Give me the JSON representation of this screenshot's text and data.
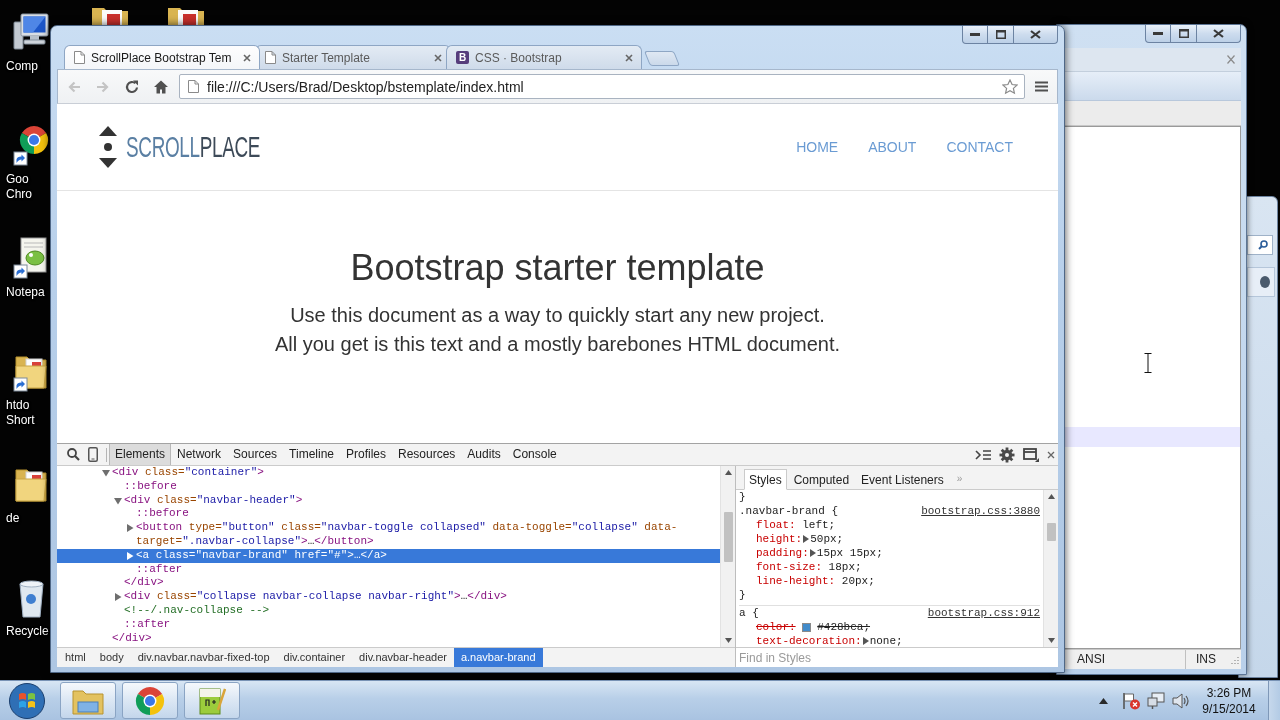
{
  "desktop_icons": [
    {
      "kind": "computer",
      "label_lines": [
        "Comp"
      ]
    },
    {
      "kind": "browser",
      "label_lines": [
        "Goo",
        "Chro"
      ]
    },
    {
      "kind": "notepad",
      "label_lines": [
        "Notepa"
      ]
    },
    {
      "kind": "folder_shortcut",
      "label_lines": [
        "htdo",
        "Short"
      ]
    },
    {
      "kind": "folder",
      "label_lines": [
        "de"
      ]
    },
    {
      "kind": "recycle_bin",
      "label_lines": [
        "Recycle"
      ]
    }
  ],
  "browser": {
    "tabs": [
      {
        "title": "ScrollPlace Bootstrap Tem",
        "kind": "page",
        "selected": true
      },
      {
        "title": "Starter Template",
        "kind": "page",
        "selected": false
      },
      {
        "title": "CSS · Bootstrap",
        "kind": "lettered",
        "favicon_letter": "B",
        "selected": false
      }
    ],
    "nav_buttons": [
      {
        "kind": "back",
        "disabled": true
      },
      {
        "kind": "forward",
        "disabled": true
      },
      {
        "kind": "reload",
        "disabled": false
      },
      {
        "kind": "home",
        "disabled": false
      }
    ],
    "address": "file:///C:/Users/Brad/Desktop/bstemplate/index.html",
    "page": {
      "brand": {
        "first": "SCROLL",
        "second": "PLACE"
      },
      "nav_links": [
        "HOME",
        "ABOUT",
        "CONTACT"
      ],
      "heading": "Bootstrap starter template",
      "lead_lines": [
        "Use this document as a way to quickly start any new project.",
        "All you get is this text and a mostly barebones HTML document."
      ]
    },
    "devtools": {
      "tools": [
        {
          "label": "Elements",
          "selected": true
        },
        {
          "label": "Network",
          "selected": false
        },
        {
          "label": "Sources",
          "selected": false
        },
        {
          "label": "Timeline",
          "selected": false
        },
        {
          "label": "Profiles",
          "selected": false
        },
        {
          "label": "Resources",
          "selected": false
        },
        {
          "label": "Audits",
          "selected": false
        },
        {
          "label": "Console",
          "selected": false
        }
      ],
      "dom_tree": [
        {
          "segments": [
            {
              "kind": "tag",
              "text": "<div"
            },
            {
              "kind": "attr",
              "text": " class="
            },
            {
              "kind": "value",
              "text": "\"container\""
            },
            {
              "kind": "tag",
              "text": ">"
            }
          ],
          "expanded": true,
          "selected": false,
          "children": [
            {
              "segments": [
                {
                  "kind": "pseudo",
                  "text": "::before"
                }
              ],
              "selected": false
            },
            {
              "segments": [
                {
                  "kind": "tag",
                  "text": "<div"
                },
                {
                  "kind": "attr",
                  "text": " class="
                },
                {
                  "kind": "value",
                  "text": "\"navbar-header\""
                },
                {
                  "kind": "tag",
                  "text": ">"
                }
              ],
              "expanded": true,
              "selected": false,
              "children": [
                {
                  "segments": [
                    {
                      "kind": "pseudo",
                      "text": "::before"
                    }
                  ],
                  "selected": false
                },
                {
                  "segments": [
                    {
                      "kind": "tag",
                      "text": "<button"
                    },
                    {
                      "kind": "attr",
                      "text": " type="
                    },
                    {
                      "kind": "value",
                      "text": "\"button\""
                    },
                    {
                      "kind": "attr",
                      "text": " class="
                    },
                    {
                      "kind": "value",
                      "text": "\"navbar-toggle collapsed\""
                    },
                    {
                      "kind": "attr",
                      "text": " data-toggle="
                    },
                    {
                      "kind": "value",
                      "text": "\"collapse\""
                    },
                    {
                      "kind": "attr",
                      "text": " data-target="
                    },
                    {
                      "kind": "value",
                      "text": "\".navbar-collapse\""
                    },
                    {
                      "kind": "tag",
                      "text": ">"
                    },
                    {
                      "kind": "text",
                      "text": "…"
                    },
                    {
                      "kind": "tag",
                      "text": "</button>"
                    }
                  ],
                  "expanded": false,
                  "selected": false
                },
                {
                  "segments": [
                    {
                      "kind": "tag",
                      "text": "<a"
                    },
                    {
                      "kind": "attr",
                      "text": " class="
                    },
                    {
                      "kind": "value",
                      "text": "\"navbar-brand\""
                    },
                    {
                      "kind": "attr",
                      "text": " href="
                    },
                    {
                      "kind": "value",
                      "text": "\"#\""
                    },
                    {
                      "kind": "tag",
                      "text": ">"
                    },
                    {
                      "kind": "text",
                      "text": "…"
                    },
                    {
                      "kind": "tag",
                      "text": "</a>"
                    }
                  ],
                  "expanded": false,
                  "selected": true
                },
                {
                  "segments": [
                    {
                      "kind": "pseudo",
                      "text": "::after"
                    }
                  ],
                  "selected": false
                }
              ],
              "end": [
                {
                  "kind": "tag",
                  "text": "</div>"
                }
              ]
            },
            {
              "segments": [
                {
                  "kind": "tag",
                  "text": "<div"
                },
                {
                  "kind": "attr",
                  "text": " class="
                },
                {
                  "kind": "value",
                  "text": "\"collapse navbar-collapse navbar-right\""
                },
                {
                  "kind": "tag",
                  "text": ">"
                },
                {
                  "kind": "text",
                  "text": "…"
                },
                {
                  "kind": "tag",
                  "text": "</div>"
                }
              ],
              "expanded": false,
              "selected": false
            },
            {
              "segments": [
                {
                  "kind": "comment",
                  "text": "<!--/.nav-collapse -->"
                }
              ],
              "selected": false
            },
            {
              "segments": [
                {
                  "kind": "pseudo",
                  "text": "::after"
                }
              ],
              "selected": false
            }
          ],
          "end": [
            {
              "kind": "tag",
              "text": "</div>"
            }
          ]
        }
      ],
      "breadcrumbs": [
        {
          "label": "html",
          "selected": false
        },
        {
          "label": "body",
          "selected": false
        },
        {
          "label": "div.navbar.navbar-fixed-top",
          "selected": false
        },
        {
          "label": "div.container",
          "selected": false
        },
        {
          "label": "div.navbar-header",
          "selected": false
        },
        {
          "label": "a.navbar-brand",
          "selected": true
        }
      ],
      "sidebar_tabs": [
        {
          "label": "Styles",
          "selected": true
        },
        {
          "label": "Computed",
          "selected": false
        },
        {
          "label": "Event Listeners",
          "selected": false
        }
      ],
      "more_tabs": "»",
      "styles": {
        "leading_text": "}",
        "rules": [
          {
            "selector": ".navbar-brand {",
            "source": "bootstrap.css:3880",
            "properties": [
              {
                "name": "float:",
                "value": "left;",
                "expandable": false,
                "overridden": false
              },
              {
                "name": "height:",
                "value": "50px;",
                "expandable": true,
                "overridden": false
              },
              {
                "name": "padding:",
                "value": "15px 15px;",
                "expandable": true,
                "overridden": false
              },
              {
                "name": "font-size:",
                "value": "18px;",
                "expandable": false,
                "overridden": false
              },
              {
                "name": "line-height:",
                "value": "20px;",
                "expandable": false,
                "overridden": false
              }
            ],
            "closing": "}"
          },
          {
            "selector": "a {",
            "source": "bootstrap.css:912",
            "properties": [
              {
                "name": "color:",
                "value": "#428bca;",
                "color": "#428bca",
                "expandable": false,
                "overridden": true
              },
              {
                "name": "text-decoration:",
                "value": "none;",
                "expandable": true,
                "overridden": false
              }
            ]
          }
        ]
      },
      "filter_placeholder": "Find in Styles"
    }
  },
  "editor": {
    "status_items": [
      "ANSI",
      "INS"
    ]
  },
  "taskbar": {
    "apps": [
      {
        "kind": "folder"
      },
      {
        "kind": "browser"
      },
      {
        "kind": "notepad"
      }
    ],
    "time": "3:26 PM",
    "date": "9/15/2014"
  }
}
